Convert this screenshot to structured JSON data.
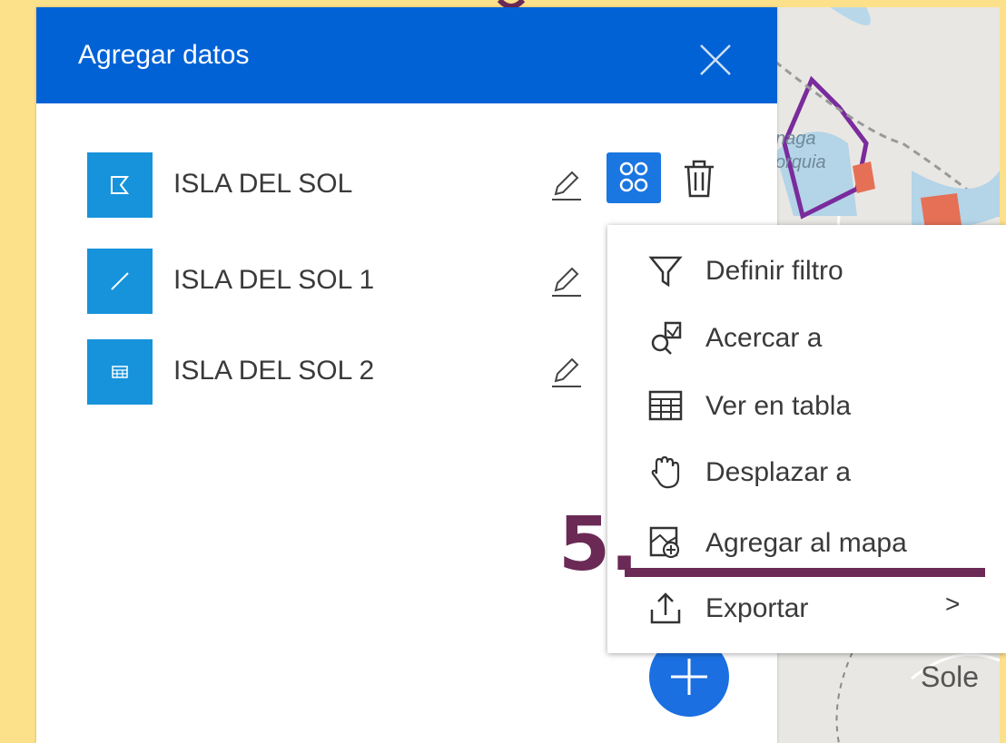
{
  "panel": {
    "title": "Agregar datos",
    "close_icon": "close-icon"
  },
  "layers": [
    {
      "name": "ISLA DEL SOL",
      "icon": "polygon-icon"
    },
    {
      "name": "ISLA DEL SOL 1",
      "icon": "line-icon"
    },
    {
      "name": "ISLA DEL SOL 2",
      "icon": "table-icon"
    }
  ],
  "row_actions": {
    "edit_icon": "pencil-icon",
    "more_icon": "grid-menu-icon",
    "delete_icon": "trash-icon"
  },
  "menu": {
    "items": [
      {
        "label": "Definir filtro",
        "icon": "filter-icon"
      },
      {
        "label": "Acercar a",
        "icon": "zoom-to-icon"
      },
      {
        "label": "Ver en tabla",
        "icon": "table-view-icon"
      },
      {
        "label": "Desplazar a",
        "icon": "pan-hand-icon"
      },
      {
        "label": "Agregar al mapa",
        "icon": "add-to-map-icon"
      },
      {
        "label": "Exportar",
        "icon": "export-icon",
        "submenu_icon": "chevron-right-icon",
        "chevron": ">"
      }
    ]
  },
  "annotation": {
    "step": "5."
  },
  "map": {
    "labels": [
      "naga",
      "orquia",
      "Sole"
    ]
  },
  "fab": {
    "icon": "plus-icon"
  },
  "colors": {
    "header": "#0162d6",
    "tile": "#1793db",
    "accent_button": "#1a76e0",
    "annotation": "#6a2a55",
    "background": "#fde08a"
  }
}
